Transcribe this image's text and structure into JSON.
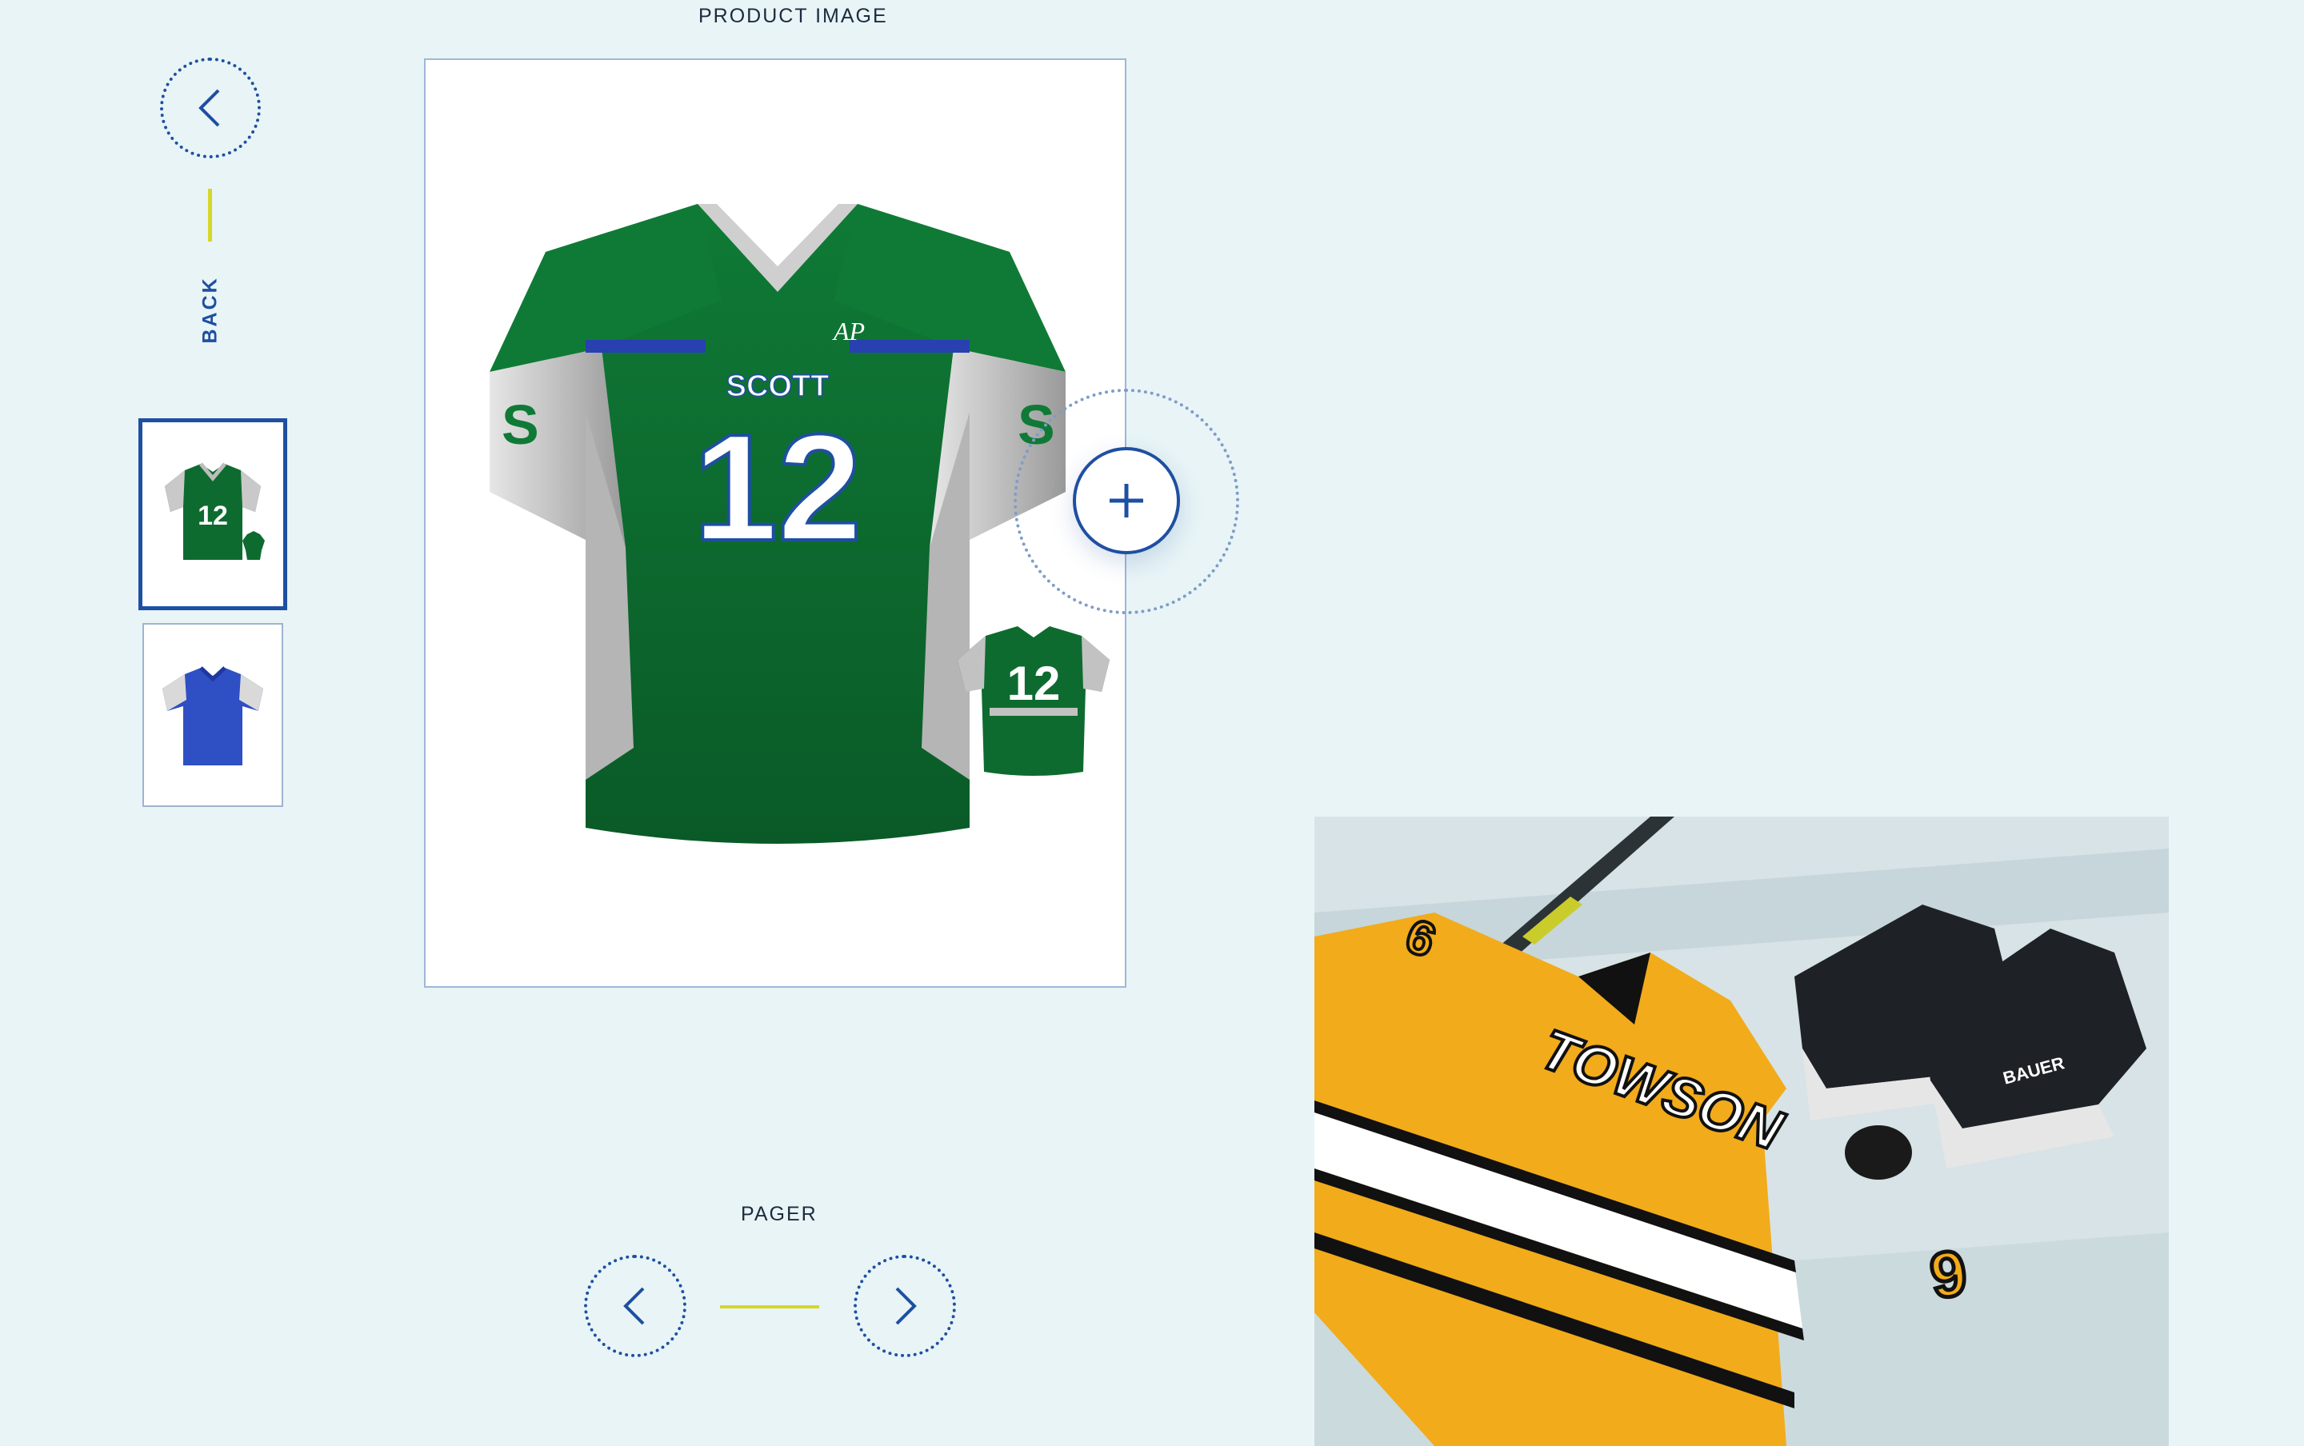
{
  "labels": {
    "product_image": "PRODUCT IMAGE",
    "pager": "PAGER",
    "back": "BACK"
  },
  "jersey": {
    "name": "SCOTT",
    "number": "12",
    "brand": "AP",
    "sleeve_letter": "S"
  },
  "lifestyle": {
    "wordmark": "TOWSON",
    "number": "9",
    "skate_brand": "BAUER"
  },
  "colors": {
    "accent": "#1e4fa1",
    "divider": "#d6d72a",
    "background": "#e8f4f6",
    "jersey_green": "#0e6b2f",
    "jersey_blue": "#2f4fc4",
    "hockey_gold": "#f2ab1a"
  },
  "thumbnails": [
    {
      "name": "green-jersey-thumbnail",
      "selected": true
    },
    {
      "name": "blue-jersey-thumbnail",
      "selected": false
    }
  ]
}
